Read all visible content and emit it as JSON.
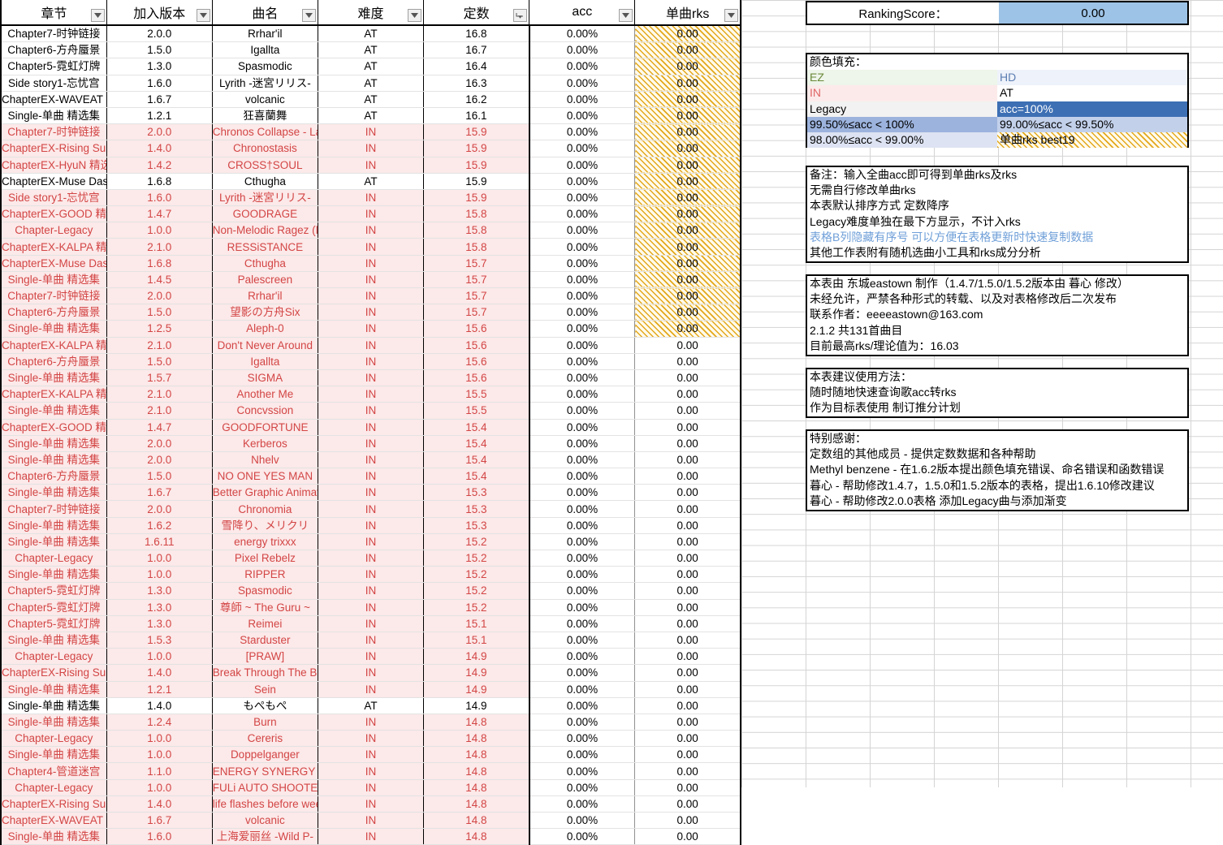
{
  "table": {
    "columns": [
      {
        "key": "chapter",
        "label": "章节",
        "filter": "dropdown"
      },
      {
        "key": "version",
        "label": "加入版本",
        "filter": "dropdown"
      },
      {
        "key": "song",
        "label": "曲名",
        "filter": "dropdown"
      },
      {
        "key": "difficulty",
        "label": "难度",
        "filter": "dropdown"
      },
      {
        "key": "constant",
        "label": "定数",
        "filter": "sorted-desc"
      },
      {
        "key": "acc",
        "label": "acc",
        "filter": "dropdown"
      },
      {
        "key": "rks",
        "label": "单曲rks",
        "filter": "dropdown"
      }
    ],
    "rows": [
      {
        "chapter": "Chapter7-时钟链接",
        "version": "2.0.0",
        "song": "Rrhar'il",
        "difficulty": "AT",
        "constant": "16.8",
        "acc": "0.00%",
        "rks": "0.00",
        "best19": true
      },
      {
        "chapter": "Chapter6-方舟蜃景",
        "version": "1.5.0",
        "song": "Igallta",
        "difficulty": "AT",
        "constant": "16.7",
        "acc": "0.00%",
        "rks": "0.00",
        "best19": true
      },
      {
        "chapter": "Chapter5-霓虹灯牌",
        "version": "1.3.0",
        "song": "Spasmodic",
        "difficulty": "AT",
        "constant": "16.4",
        "acc": "0.00%",
        "rks": "0.00",
        "best19": true
      },
      {
        "chapter": "Side story1-忘忧宫",
        "version": "1.6.0",
        "song": "Lyrith -迷宮リリス-",
        "difficulty": "AT",
        "constant": "16.3",
        "acc": "0.00%",
        "rks": "0.00",
        "best19": true
      },
      {
        "chapter": "ChapterEX-WAVEAT 精选集",
        "version": "1.6.7",
        "song": "volcanic",
        "difficulty": "AT",
        "constant": "16.2",
        "acc": "0.00%",
        "rks": "0.00",
        "best19": true
      },
      {
        "chapter": "Single-单曲 精选集",
        "version": "1.2.1",
        "song": "狂喜蘭舞",
        "difficulty": "AT",
        "constant": "16.1",
        "acc": "0.00%",
        "rks": "0.00",
        "best19": true
      },
      {
        "chapter": "Chapter7-时钟链接",
        "version": "2.0.0",
        "song": "Chronos Collapse - La Campanella",
        "difficulty": "IN",
        "constant": "15.9",
        "acc": "0.00%",
        "rks": "0.00",
        "best19": true
      },
      {
        "chapter": "ChapterEX-Rising Sun Traxx 精选集",
        "version": "1.4.0",
        "song": "Chronostasis",
        "difficulty": "IN",
        "constant": "15.9",
        "acc": "0.00%",
        "rks": "0.00",
        "best19": true
      },
      {
        "chapter": "ChapterEX-HyuN 精选集",
        "version": "1.4.2",
        "song": "CROSS†SOUL",
        "difficulty": "IN",
        "constant": "15.9",
        "acc": "0.00%",
        "rks": "0.00",
        "best19": true
      },
      {
        "chapter": "ChapterEX-Muse Dash 精选集",
        "version": "1.6.8",
        "song": "Cthugha",
        "difficulty": "AT",
        "constant": "15.9",
        "acc": "0.00%",
        "rks": "0.00",
        "best19": true
      },
      {
        "chapter": "Side story1-忘忧宫",
        "version": "1.6.0",
        "song": "Lyrith -迷宮リリス-",
        "difficulty": "IN",
        "constant": "15.9",
        "acc": "0.00%",
        "rks": "0.00",
        "best19": true
      },
      {
        "chapter": "ChapterEX-GOOD 精选集",
        "version": "1.4.7",
        "song": "GOODRAGE",
        "difficulty": "IN",
        "constant": "15.8",
        "acc": "0.00%",
        "rks": "0.00",
        "best19": true
      },
      {
        "chapter": "Chapter-Legacy",
        "version": "1.0.0",
        "song": "Non-Melodic Ragez (MUG Edit)",
        "difficulty": "IN",
        "constant": "15.8",
        "acc": "0.00%",
        "rks": "0.00",
        "best19": true
      },
      {
        "chapter": "ChapterEX-KALPA 精选集",
        "version": "2.1.0",
        "song": "RESSiSTANCE",
        "difficulty": "IN",
        "constant": "15.8",
        "acc": "0.00%",
        "rks": "0.00",
        "best19": true
      },
      {
        "chapter": "ChapterEX-Muse Dash 精选集",
        "version": "1.6.8",
        "song": "Cthugha",
        "difficulty": "IN",
        "constant": "15.7",
        "acc": "0.00%",
        "rks": "0.00",
        "best19": true
      },
      {
        "chapter": "Single-单曲 精选集",
        "version": "1.4.5",
        "song": "Palescreen",
        "difficulty": "IN",
        "constant": "15.7",
        "acc": "0.00%",
        "rks": "0.00",
        "best19": true
      },
      {
        "chapter": "Chapter7-时钟链接",
        "version": "2.0.0",
        "song": "Rrhar'il",
        "difficulty": "IN",
        "constant": "15.7",
        "acc": "0.00%",
        "rks": "0.00",
        "best19": true
      },
      {
        "chapter": "Chapter6-方舟蜃景",
        "version": "1.5.0",
        "song": "望影の方舟Six",
        "difficulty": "IN",
        "constant": "15.7",
        "acc": "0.00%",
        "rks": "0.00",
        "best19": true
      },
      {
        "chapter": "Single-单曲 精选集",
        "version": "1.2.5",
        "song": "Aleph-0",
        "difficulty": "IN",
        "constant": "15.6",
        "acc": "0.00%",
        "rks": "0.00",
        "best19": true
      },
      {
        "chapter": "ChapterEX-KALPA 精选集",
        "version": "2.1.0",
        "song": "Don't Never Around",
        "difficulty": "IN",
        "constant": "15.6",
        "acc": "0.00%",
        "rks": "0.00",
        "best19": false
      },
      {
        "chapter": "Chapter6-方舟蜃景",
        "version": "1.5.0",
        "song": "Igallta",
        "difficulty": "IN",
        "constant": "15.6",
        "acc": "0.00%",
        "rks": "0.00",
        "best19": false
      },
      {
        "chapter": "Single-单曲 精选集",
        "version": "1.5.7",
        "song": "SIGMA",
        "difficulty": "IN",
        "constant": "15.6",
        "acc": "0.00%",
        "rks": "0.00",
        "best19": false
      },
      {
        "chapter": "ChapterEX-KALPA 精选集",
        "version": "2.1.0",
        "song": "Another Me",
        "difficulty": "IN",
        "constant": "15.5",
        "acc": "0.00%",
        "rks": "0.00",
        "best19": false
      },
      {
        "chapter": "Single-单曲 精选集",
        "version": "2.1.0",
        "song": "Concvssion",
        "difficulty": "IN",
        "constant": "15.5",
        "acc": "0.00%",
        "rks": "0.00",
        "best19": false
      },
      {
        "chapter": "ChapterEX-GOOD 精选集",
        "version": "1.4.7",
        "song": "GOODFORTUNE",
        "difficulty": "IN",
        "constant": "15.4",
        "acc": "0.00%",
        "rks": "0.00",
        "best19": false
      },
      {
        "chapter": "Single-单曲 精选集",
        "version": "2.0.0",
        "song": "Kerberos",
        "difficulty": "IN",
        "constant": "15.4",
        "acc": "0.00%",
        "rks": "0.00",
        "best19": false
      },
      {
        "chapter": "Single-单曲 精选集",
        "version": "2.0.0",
        "song": "Nhelv",
        "difficulty": "IN",
        "constant": "15.4",
        "acc": "0.00%",
        "rks": "0.00",
        "best19": false
      },
      {
        "chapter": "Chapter6-方舟蜃景",
        "version": "1.5.0",
        "song": "NO ONE YES MAN",
        "difficulty": "IN",
        "constant": "15.4",
        "acc": "0.00%",
        "rks": "0.00",
        "best19": false
      },
      {
        "chapter": "Single-单曲 精选集",
        "version": "1.6.7",
        "song": "Better Graphic Animation",
        "difficulty": "IN",
        "constant": "15.3",
        "acc": "0.00%",
        "rks": "0.00",
        "best19": false
      },
      {
        "chapter": "Chapter7-时钟链接",
        "version": "2.0.0",
        "song": "Chronomia",
        "difficulty": "IN",
        "constant": "15.3",
        "acc": "0.00%",
        "rks": "0.00",
        "best19": false
      },
      {
        "chapter": "Single-单曲 精选集",
        "version": "1.6.2",
        "song": "雪降り、メリクリ",
        "difficulty": "IN",
        "constant": "15.3",
        "acc": "0.00%",
        "rks": "0.00",
        "best19": false
      },
      {
        "chapter": "Single-单曲 精选集",
        "version": "1.6.11",
        "song": "energy trixxx",
        "difficulty": "IN",
        "constant": "15.2",
        "acc": "0.00%",
        "rks": "0.00",
        "best19": false
      },
      {
        "chapter": "Chapter-Legacy",
        "version": "1.0.0",
        "song": "Pixel Rebelz",
        "difficulty": "IN",
        "constant": "15.2",
        "acc": "0.00%",
        "rks": "0.00",
        "best19": false
      },
      {
        "chapter": "Single-单曲 精选集",
        "version": "1.0.0",
        "song": "RIPPER",
        "difficulty": "IN",
        "constant": "15.2",
        "acc": "0.00%",
        "rks": "0.00",
        "best19": false
      },
      {
        "chapter": "Chapter5-霓虹灯牌",
        "version": "1.3.0",
        "song": "Spasmodic",
        "difficulty": "IN",
        "constant": "15.2",
        "acc": "0.00%",
        "rks": "0.00",
        "best19": false
      },
      {
        "chapter": "Chapter5-霓虹灯牌",
        "version": "1.3.0",
        "song": "尊師 ~ The Guru ~",
        "difficulty": "IN",
        "constant": "15.2",
        "acc": "0.00%",
        "rks": "0.00",
        "best19": false
      },
      {
        "chapter": "Chapter5-霓虹灯牌",
        "version": "1.3.0",
        "song": "Reimei",
        "difficulty": "IN",
        "constant": "15.1",
        "acc": "0.00%",
        "rks": "0.00",
        "best19": false
      },
      {
        "chapter": "Single-单曲 精选集",
        "version": "1.5.3",
        "song": "Starduster",
        "difficulty": "IN",
        "constant": "15.1",
        "acc": "0.00%",
        "rks": "0.00",
        "best19": false
      },
      {
        "chapter": "Chapter-Legacy",
        "version": "1.0.0",
        "song": "[PRAW]",
        "difficulty": "IN",
        "constant": "14.9",
        "acc": "0.00%",
        "rks": "0.00",
        "best19": false
      },
      {
        "chapter": "ChapterEX-Rising Sun Traxx 精选集",
        "version": "1.4.0",
        "song": "Break Through The Barrier",
        "difficulty": "IN",
        "constant": "14.9",
        "acc": "0.00%",
        "rks": "0.00",
        "best19": false
      },
      {
        "chapter": "Single-单曲 精选集",
        "version": "1.2.1",
        "song": "Sein",
        "difficulty": "IN",
        "constant": "14.9",
        "acc": "0.00%",
        "rks": "0.00",
        "best19": false
      },
      {
        "chapter": "Single-单曲 精选集",
        "version": "1.4.0",
        "song": "もぺもぺ",
        "difficulty": "AT",
        "constant": "14.9",
        "acc": "0.00%",
        "rks": "0.00",
        "best19": false
      },
      {
        "chapter": "Single-单曲 精选集",
        "version": "1.2.4",
        "song": "Burn",
        "difficulty": "IN",
        "constant": "14.8",
        "acc": "0.00%",
        "rks": "0.00",
        "best19": false
      },
      {
        "chapter": "Chapter-Legacy",
        "version": "1.0.0",
        "song": "Cereris",
        "difficulty": "IN",
        "constant": "14.8",
        "acc": "0.00%",
        "rks": "0.00",
        "best19": false
      },
      {
        "chapter": "Single-单曲 精选集",
        "version": "1.0.0",
        "song": "Doppelganger",
        "difficulty": "IN",
        "constant": "14.8",
        "acc": "0.00%",
        "rks": "0.00",
        "best19": false
      },
      {
        "chapter": "Chapter4-管道迷宫",
        "version": "1.1.0",
        "song": "ENERGY SYNERGY MATRIX",
        "difficulty": "IN",
        "constant": "14.8",
        "acc": "0.00%",
        "rks": "0.00",
        "best19": false
      },
      {
        "chapter": "Chapter-Legacy",
        "version": "1.0.0",
        "song": "FULi AUTO SHOOTER",
        "difficulty": "IN",
        "constant": "14.8",
        "acc": "0.00%",
        "rks": "0.00",
        "best19": false
      },
      {
        "chapter": "ChapterEX-Rising Sun Traxx 精选集",
        "version": "1.4.0",
        "song": "life flashes before weeb eyes",
        "difficulty": "IN",
        "constant": "14.8",
        "acc": "0.00%",
        "rks": "0.00",
        "best19": false
      },
      {
        "chapter": "ChapterEX-WAVEAT 精选集",
        "version": "1.6.7",
        "song": "volcanic",
        "difficulty": "IN",
        "constant": "14.8",
        "acc": "0.00%",
        "rks": "0.00",
        "best19": false
      },
      {
        "chapter": "Single-单曲 精选集",
        "version": "1.6.0",
        "song": "上海爱丽丝 -Wild P-",
        "difficulty": "IN",
        "constant": "14.8",
        "acc": "0.00%",
        "rks": "0.00",
        "best19": false
      }
    ]
  },
  "ranking": {
    "label": "RankingScore：",
    "value": "0.00"
  },
  "legend": {
    "title": "颜色填充：",
    "rows": [
      {
        "left": "EZ",
        "right": "HD"
      },
      {
        "left": "IN",
        "right": "AT"
      },
      {
        "left": "Legacy",
        "right": "acc=100%"
      },
      {
        "left": "99.50%≤acc < 100%",
        "right": "99.00%≤acc < 99.50%"
      },
      {
        "left": "98.00%≤acc < 99.00%",
        "right": "单曲rks best19"
      }
    ]
  },
  "notes": {
    "lines": [
      "备注：输入全曲acc即可得到单曲rks及rks",
      "无需自行修改单曲rks",
      "本表默认排序方式 定数降序",
      "Legacy难度单独在最下方显示，不计入rks",
      "表格B列隐藏有序号 可以方便在表格更新时快速复制数据",
      "其他工作表附有随机选曲小工具和rks成分分析"
    ]
  },
  "credit": {
    "lines": [
      "本表由 东城eastown 制作（1.4.7/1.5.0/1.5.2版本由 暮心 修改）",
      "未经允许，严禁各种形式的转载、以及对表格修改后二次发布",
      "联系作者：eeeeastown@163.com",
      "2.1.2 共131首曲目",
      "目前最高rks/理论值为：16.03"
    ]
  },
  "usage": {
    "lines": [
      "本表建议使用方法：",
      "随时随地快速查询歌acc转rks",
      "作为目标表使用 制订推分计划"
    ]
  },
  "thanks": {
    "lines": [
      "特别感谢：",
      "定数组的其他成员 - 提供定数数据和各种帮助",
      "Methyl benzene - 在1.6.2版本提出颜色填充错误、命名错误和函数错误",
      "暮心 - 帮助修改1.4.7，1.5.0和1.5.2版本的表格，提出1.6.10修改建议",
      "暮心 - 帮助修改2.0.0表格 添加Legacy曲与添加渐变"
    ]
  },
  "colors": {
    "in_text": "#d34545",
    "in_bg": "#fce9e9",
    "best19_hatch": "#e3a81b",
    "ranking_value_bg": "#9dc3e6",
    "acc100_bg": "#3d6fb4"
  }
}
